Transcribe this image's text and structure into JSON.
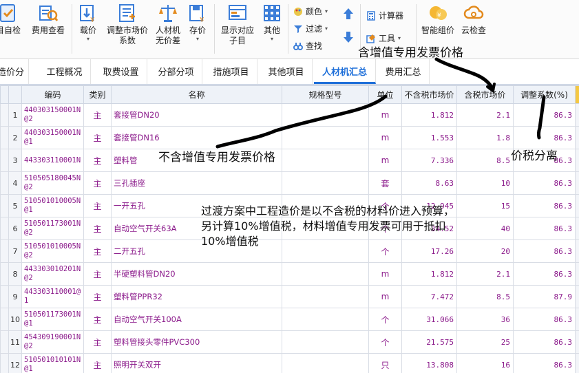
{
  "ribbon": {
    "buttons": [
      {
        "label": "目自检",
        "icon": "self-check-icon"
      },
      {
        "label": "费用查看",
        "icon": "cost-view-icon"
      },
      {
        "label": "载价",
        "icon": "load-price-icon",
        "has_dropdown": true
      },
      {
        "label": "调整市场价",
        "label2": "系数",
        "icon": "adjust-price-icon"
      },
      {
        "label": "人材机",
        "label2": "无价差",
        "icon": "scale-icon"
      },
      {
        "label": "存价",
        "icon": "save-price-icon",
        "has_dropdown": true
      },
      {
        "label": "显示对应",
        "label2": "子目",
        "icon": "show-sub-icon"
      },
      {
        "label": "其他",
        "icon": "grid-icon",
        "has_dropdown": true
      }
    ],
    "small": [
      {
        "label": "颜色",
        "icon": "color-icon"
      },
      {
        "label": "过滤",
        "icon": "filter-icon"
      },
      {
        "label": "查找",
        "icon": "binoculars-icon"
      },
      {
        "label": "计算器",
        "icon": "calculator-icon"
      },
      {
        "label": "工具",
        "icon": "tools-icon"
      }
    ],
    "right": [
      {
        "label": "智能组价",
        "icon": "smart-price-icon"
      },
      {
        "label": "云检查",
        "icon": "cloud-check-icon"
      }
    ]
  },
  "tabs": [
    "造价分析",
    "工程概况",
    "取费设置",
    "分部分项",
    "措施项目",
    "其他项目",
    "人材机汇总",
    "费用汇总"
  ],
  "active_tab": "人材机汇总",
  "table": {
    "headers": [
      "编码",
      "类别",
      "名称",
      "规格型号",
      "单位",
      "不含税市场价",
      "含税市场价",
      "调整系数(%)"
    ],
    "rows": [
      {
        "n": "1",
        "code": "440303150001N@2",
        "type": "主",
        "name": "套接管DN20",
        "spec": "",
        "unit": "m",
        "p1": "1.812",
        "p2": "2.1",
        "k": "86.3"
      },
      {
        "n": "2",
        "code": "440303150001N@1",
        "type": "主",
        "name": "套接管DN16",
        "spec": "",
        "unit": "m",
        "p1": "1.553",
        "p2": "1.8",
        "k": "86.3"
      },
      {
        "n": "3",
        "code": "443303110001N",
        "type": "主",
        "name": "塑料管",
        "spec": "",
        "unit": "m",
        "p1": "7.336",
        "p2": "8.5",
        "k": "86.3"
      },
      {
        "n": "4",
        "code": "510505180045N@2",
        "type": "主",
        "name": "三孔插座",
        "spec": "",
        "unit": "套",
        "p1": "8.63",
        "p2": "10",
        "k": "86.3"
      },
      {
        "n": "5",
        "code": "510501010005N@1",
        "type": "主",
        "name": "一开五孔",
        "spec": "",
        "unit": "个",
        "p1": "12.945",
        "p2": "15",
        "k": "86.3"
      },
      {
        "n": "6",
        "code": "510501173001N@2",
        "type": "主",
        "name": "自动空气开关63A",
        "spec": "",
        "unit": "个",
        "p1": "34.52",
        "p2": "40",
        "k": "86.3"
      },
      {
        "n": "7",
        "code": "510501010005N@2",
        "type": "主",
        "name": "二开五孔",
        "spec": "",
        "unit": "个",
        "p1": "17.26",
        "p2": "20",
        "k": "86.3"
      },
      {
        "n": "8",
        "code": "443303010201N@2",
        "type": "主",
        "name": "半硬塑料管DN20",
        "spec": "",
        "unit": "m",
        "p1": "1.812",
        "p2": "2.1",
        "k": "86.3"
      },
      {
        "n": "9",
        "code": "443303110001@1",
        "type": "主",
        "name": "塑料管PPR32",
        "spec": "",
        "unit": "m",
        "p1": "7.472",
        "p2": "8.5",
        "k": "87.9"
      },
      {
        "n": "10",
        "code": "510501173001N@1",
        "type": "主",
        "name": "自动空气开关100A",
        "spec": "",
        "unit": "个",
        "p1": "31.066",
        "p2": "36",
        "k": "86.3"
      },
      {
        "n": "11",
        "code": "454309190001N@2",
        "type": "主",
        "name": "塑料管接头零件PVC300",
        "spec": "",
        "unit": "个",
        "p1": "21.575",
        "p2": "25",
        "k": "86.3"
      },
      {
        "n": "12",
        "code": "510501010101N@1",
        "type": "主",
        "name": "照明开关双开",
        "spec": "",
        "unit": "只",
        "p1": "13.808",
        "p2": "16",
        "k": "86.3"
      }
    ]
  },
  "annotations": {
    "top": "含增值专用发票价格",
    "mid": "不含增值专用发票价格",
    "right": "价税分离",
    "para_line1": "过渡方案中工程造价是以不含税的材料价进入预算，",
    "para_line2": "另计算10%增值税，材料增值专用发票可用于抵扣",
    "para_line3": "10%增值税"
  },
  "colors": {
    "accent": "#1e6fd9",
    "text_purple": "#8b1a8b",
    "header_bg": "#eef2f8"
  }
}
